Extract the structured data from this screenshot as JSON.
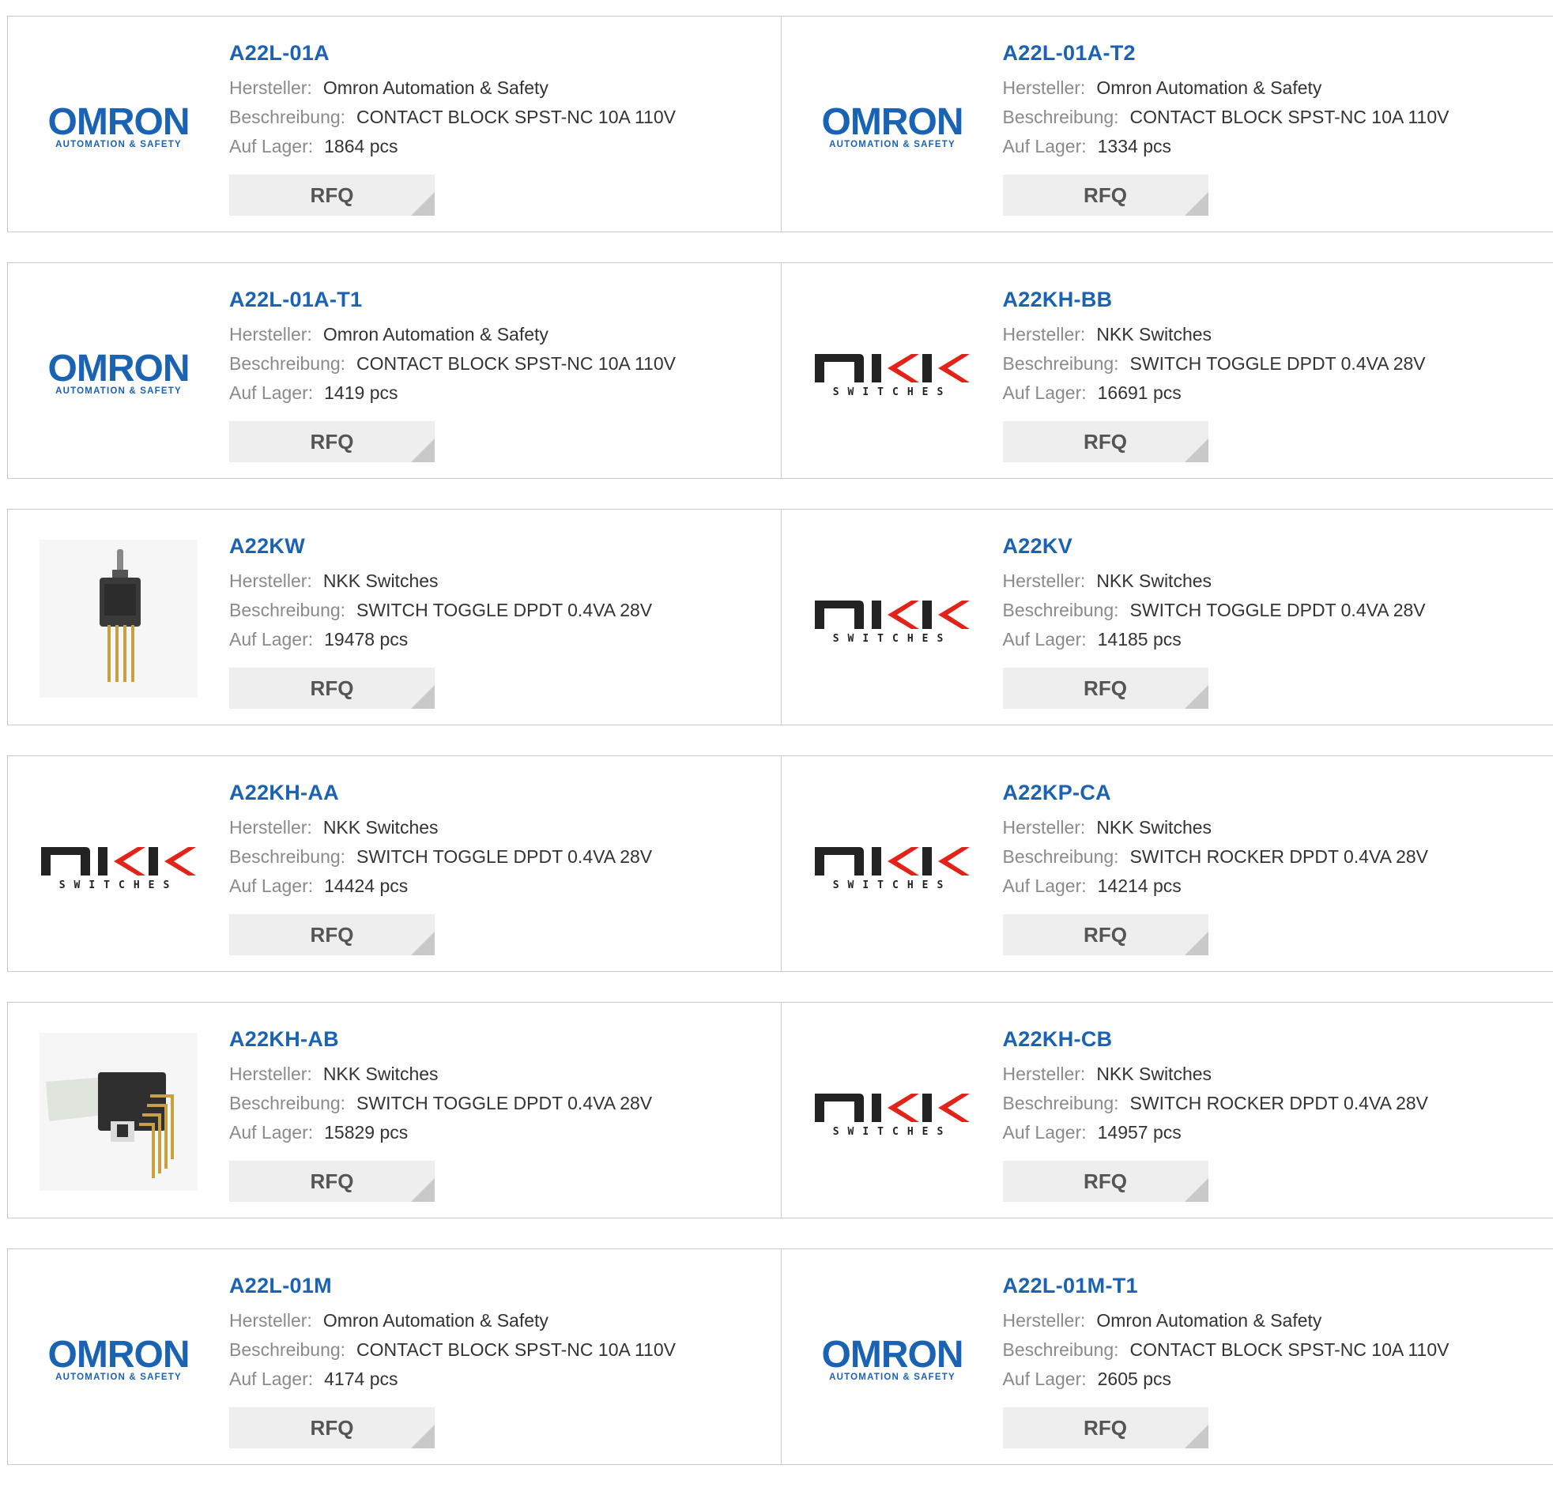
{
  "labels": {
    "manufacturer": "Hersteller:",
    "description": "Beschreibung:",
    "stock": "Auf Lager:",
    "rfq": "RFQ"
  },
  "logos": {
    "omron": {
      "name": "OMRON",
      "tagline": "AUTOMATION & SAFETY",
      "color": "#1a62b3"
    },
    "nkk": {
      "name": "NKK",
      "tagline": "SWITCHES",
      "accent": "#e2231a"
    }
  },
  "products": [
    {
      "part": "A22L-01A",
      "manufacturer": "Omron Automation & Safety",
      "description": "CONTACT BLOCK SPST-NC 10A 110V",
      "stock": "1864 pcs",
      "image": "omron-logo"
    },
    {
      "part": "A22L-01A-T2",
      "manufacturer": "Omron Automation & Safety",
      "description": "CONTACT BLOCK SPST-NC 10A 110V",
      "stock": "1334 pcs",
      "image": "omron-logo"
    },
    {
      "part": "A22L-01A-T1",
      "manufacturer": "Omron Automation & Safety",
      "description": "CONTACT BLOCK SPST-NC 10A 110V",
      "stock": "1419 pcs",
      "image": "omron-logo"
    },
    {
      "part": "A22KH-BB",
      "manufacturer": "NKK Switches",
      "description": "SWITCH TOGGLE DPDT 0.4VA 28V",
      "stock": "16691 pcs",
      "image": "nkk-logo"
    },
    {
      "part": "A22KW",
      "manufacturer": "NKK Switches",
      "description": "SWITCH TOGGLE DPDT 0.4VA 28V",
      "stock": "19478 pcs",
      "image": "toggle-switch-photo"
    },
    {
      "part": "A22KV",
      "manufacturer": "NKK Switches",
      "description": "SWITCH TOGGLE DPDT 0.4VA 28V",
      "stock": "14185 pcs",
      "image": "nkk-logo"
    },
    {
      "part": "A22KH-AA",
      "manufacturer": "NKK Switches",
      "description": "SWITCH TOGGLE DPDT 0.4VA 28V",
      "stock": "14424 pcs",
      "image": "nkk-logo"
    },
    {
      "part": "A22KP-CA",
      "manufacturer": "NKK Switches",
      "description": "SWITCH ROCKER DPDT 0.4VA 28V",
      "stock": "14214 pcs",
      "image": "nkk-logo"
    },
    {
      "part": "A22KH-AB",
      "manufacturer": "NKK Switches",
      "description": "SWITCH TOGGLE DPDT 0.4VA 28V",
      "stock": "15829 pcs",
      "image": "right-angle-switch-photo"
    },
    {
      "part": "A22KH-CB",
      "manufacturer": "NKK Switches",
      "description": "SWITCH ROCKER DPDT 0.4VA 28V",
      "stock": "14957 pcs",
      "image": "nkk-logo"
    },
    {
      "part": "A22L-01M",
      "manufacturer": "Omron Automation & Safety",
      "description": "CONTACT BLOCK SPST-NC 10A 110V",
      "stock": "4174 pcs",
      "image": "omron-logo"
    },
    {
      "part": "A22L-01M-T1",
      "manufacturer": "Omron Automation & Safety",
      "description": "CONTACT BLOCK SPST-NC 10A 110V",
      "stock": "2605 pcs",
      "image": "omron-logo"
    }
  ]
}
